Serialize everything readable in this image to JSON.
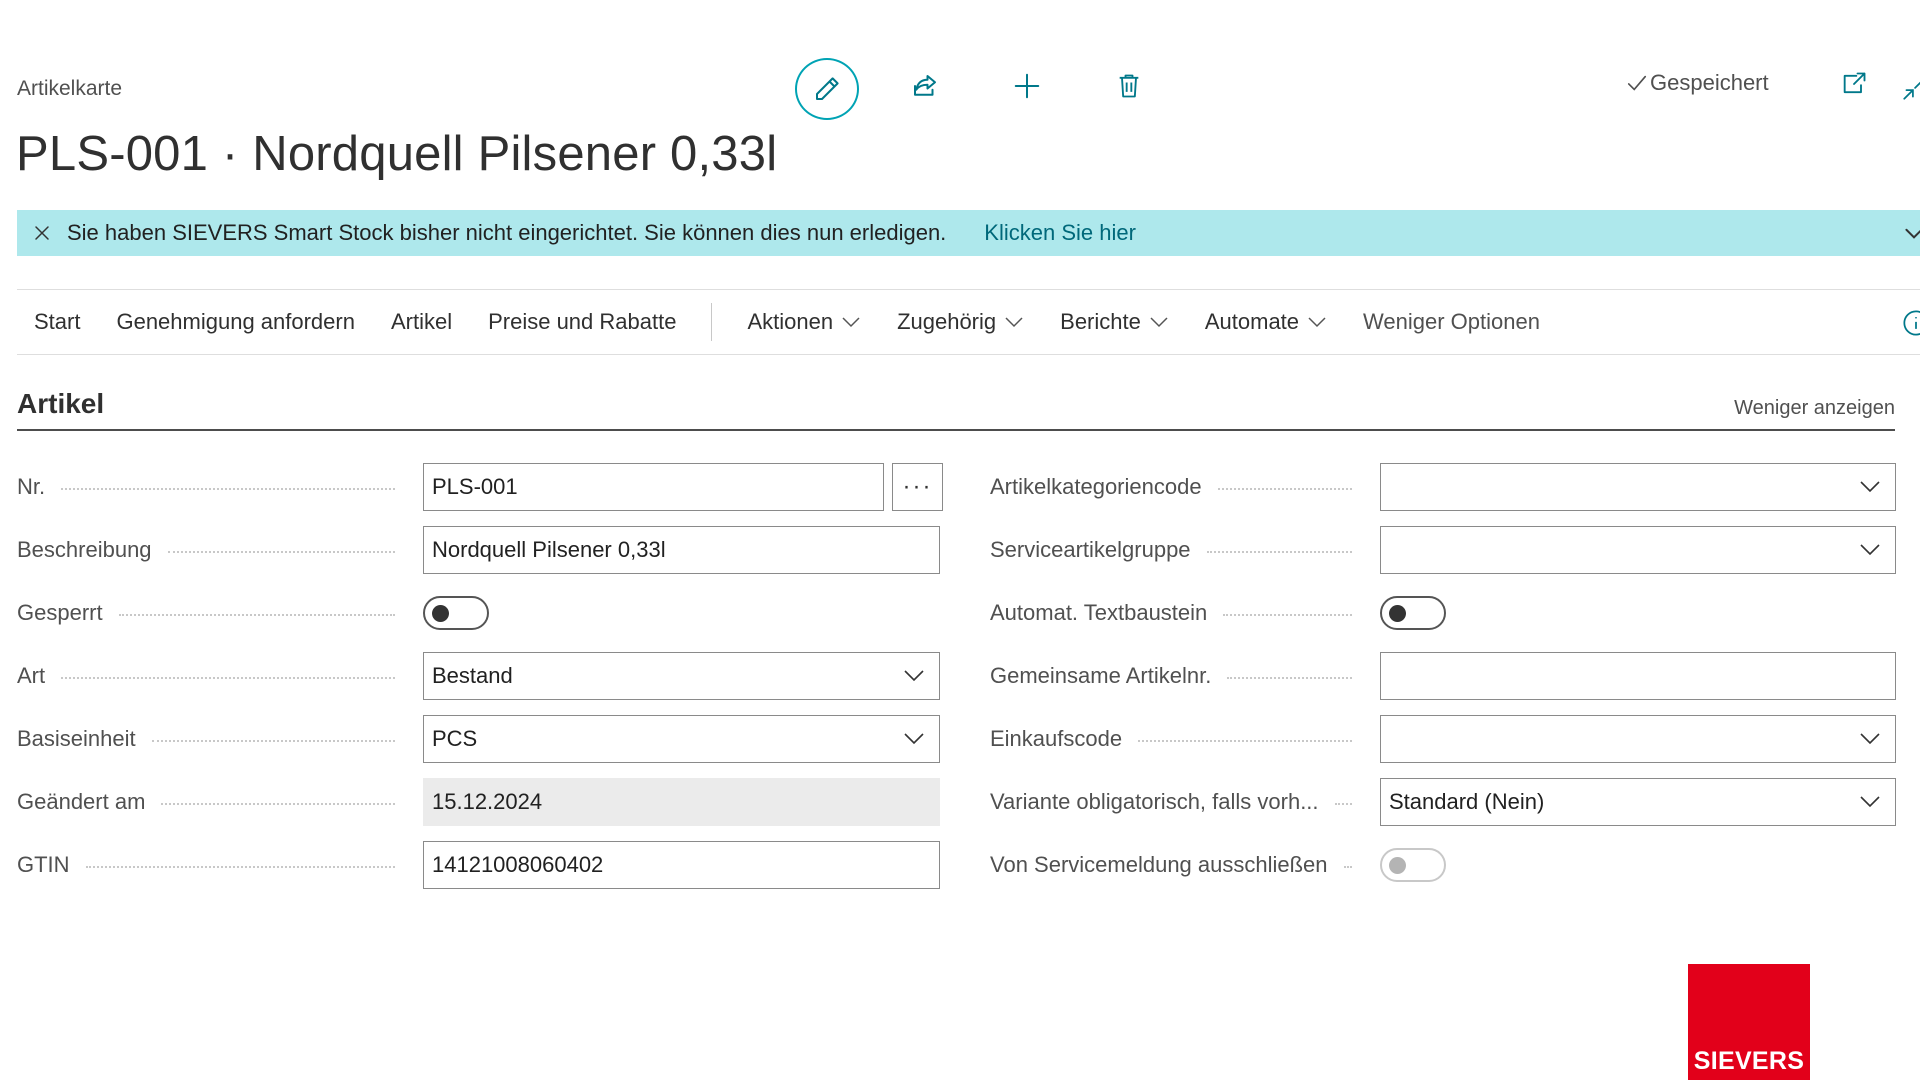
{
  "header": {
    "caption": "Artikelkarte",
    "title": "PLS-001 · Nordquell Pilsener 0,33l",
    "saved_status": "Gespeichert",
    "actions": [
      {
        "name": "edit",
        "icon": "pencil-icon"
      },
      {
        "name": "share",
        "icon": "share-icon"
      },
      {
        "name": "new",
        "icon": "plus-icon"
      },
      {
        "name": "delete",
        "icon": "trash-icon"
      }
    ]
  },
  "banner": {
    "message": "Sie haben SIEVERS Smart Stock bisher nicht eingerichtet. Sie können dies nun erledigen.",
    "link": "Klicken Sie hier",
    "background_color": "#aee8ec"
  },
  "menu": {
    "items": [
      "Start",
      "Genehmigung anfordern",
      "Artikel",
      "Preise und Rabatte"
    ],
    "dropdowns": [
      "Aktionen",
      "Zugehörig",
      "Berichte",
      "Automate"
    ],
    "less_options": "Weniger Optionen"
  },
  "section": {
    "title": "Artikel",
    "toggle_link": "Weniger anzeigen"
  },
  "fields_left": {
    "nr": {
      "label": "Nr.",
      "value": "PLS-001",
      "assist": "···"
    },
    "beschreibung": {
      "label": "Beschreibung",
      "value": "Nordquell Pilsener 0,33l"
    },
    "gesperrt": {
      "label": "Gesperrt",
      "value": false
    },
    "art": {
      "label": "Art",
      "value": "Bestand"
    },
    "basiseinheit": {
      "label": "Basiseinheit",
      "value": "PCS"
    },
    "geaendert_am": {
      "label": "Geändert am",
      "value": "15.12.2024"
    },
    "gtin": {
      "label": "GTIN",
      "value": "14121008060402"
    }
  },
  "fields_right": {
    "artikelkategoriencode": {
      "label": "Artikelkategoriencode",
      "value": ""
    },
    "serviceartikelgruppe": {
      "label": "Serviceartikelgruppe",
      "value": ""
    },
    "automat_textbaustein": {
      "label": "Automat. Textbaustein",
      "value": false
    },
    "gemeinsame_artikelnr": {
      "label": "Gemeinsame Artikelnr.",
      "value": ""
    },
    "einkaufscode": {
      "label": "Einkaufscode",
      "value": ""
    },
    "variante": {
      "label": "Variante obligatorisch, falls vorh...",
      "value": "Standard (Nein)"
    },
    "von_servicemeldung": {
      "label": "Von Servicemeldung ausschließen",
      "value": false
    }
  },
  "logo": {
    "text": "SIEVERS",
    "color": "#e2001a"
  },
  "colors": {
    "accent": "#00788a",
    "accent_ring": "#00a3b4"
  }
}
